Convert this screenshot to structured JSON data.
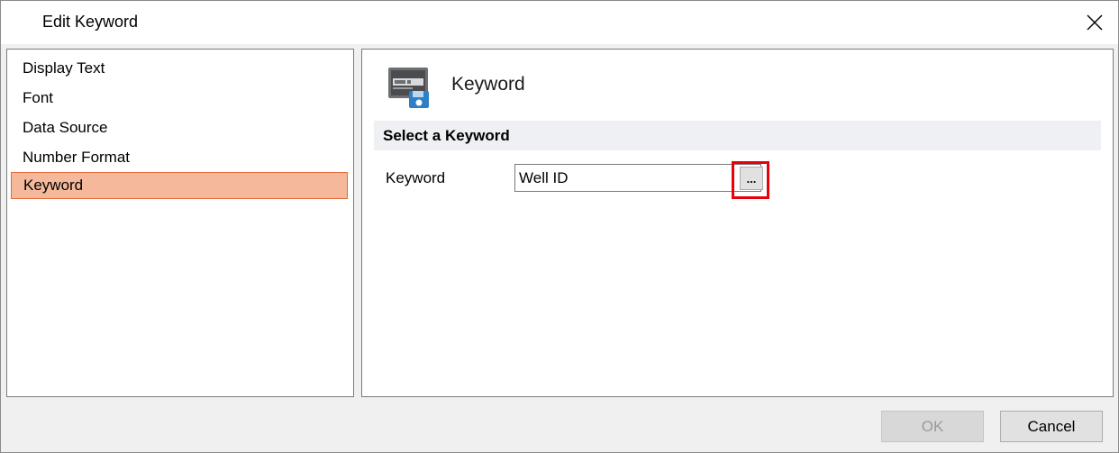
{
  "window": {
    "title": "Edit Keyword",
    "close_icon": "close-icon"
  },
  "nav": {
    "items": [
      {
        "label": "Display Text",
        "selected": false
      },
      {
        "label": "Font",
        "selected": false
      },
      {
        "label": "Data Source",
        "selected": false
      },
      {
        "label": "Number Format",
        "selected": false
      },
      {
        "label": "Keyword",
        "selected": true
      }
    ]
  },
  "content": {
    "header_icon": "keyword-icon",
    "header_title": "Keyword",
    "section_title": "Select a Keyword",
    "field_label": "Keyword",
    "field_value": "Well ID",
    "browse_label": "..."
  },
  "footer": {
    "ok_label": "OK",
    "ok_enabled": false,
    "cancel_label": "Cancel"
  },
  "colors": {
    "selected_bg": "#f5b89b",
    "selected_border": "#e26a3a",
    "highlight": "#e8000b"
  }
}
